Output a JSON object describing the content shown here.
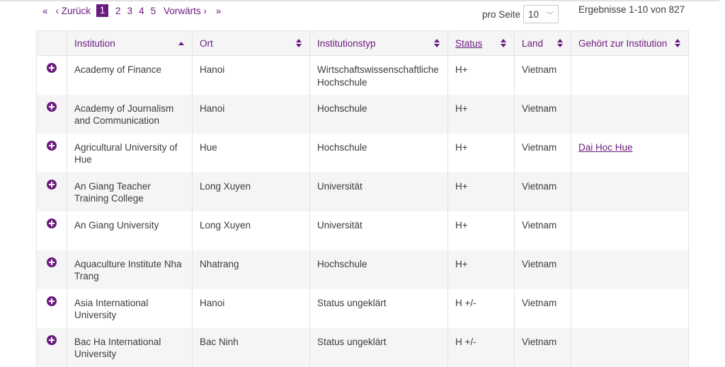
{
  "pagination": {
    "first": "«",
    "prev": "‹ Zurück",
    "pages": [
      "1",
      "2",
      "3",
      "4",
      "5"
    ],
    "current": "1",
    "next": "Vorwärts ›",
    "last": "»"
  },
  "per_page": {
    "label": "pro Seite",
    "value": "10"
  },
  "results": "Ergebnisse 1-10 von 827",
  "columns": {
    "institution": "Institution",
    "ort": "Ort",
    "typ": "Institutionstyp",
    "status": "Status",
    "land": "Land",
    "parent": "Gehört zur Institution"
  },
  "rows": [
    {
      "institution": "Academy of Finance",
      "ort": "Hanoi",
      "typ": "Wirtschaftswissenschaftliche Hochschule",
      "status": "H+",
      "land": "Vietnam",
      "parent": ""
    },
    {
      "institution": "Academy of Journalism and Communication",
      "ort": "Hanoi",
      "typ": "Hochschule",
      "status": "H+",
      "land": "Vietnam",
      "parent": ""
    },
    {
      "institution": "Agricultural University of Hue",
      "ort": "Hue",
      "typ": "Hochschule",
      "status": "H+",
      "land": "Vietnam",
      "parent": "Dai Hoc Hue"
    },
    {
      "institution": "An Giang Teacher Training College",
      "ort": "Long Xuyen",
      "typ": "Universität",
      "status": "H+",
      "land": "Vietnam",
      "parent": ""
    },
    {
      "institution": "An Giang University",
      "ort": "Long Xuyen",
      "typ": "Universität",
      "status": "H+",
      "land": "Vietnam",
      "parent": ""
    },
    {
      "institution": "Aquaculture Institute Nha Trang",
      "ort": "Nhatrang",
      "typ": "Hochschule",
      "status": "H+",
      "land": "Vietnam",
      "parent": ""
    },
    {
      "institution": "Asia International University",
      "ort": "Hanoi",
      "typ": "Status ungeklärt",
      "status": "H +/-",
      "land": "Vietnam",
      "parent": ""
    },
    {
      "institution": "Bac Ha International University",
      "ort": "Bac Ninh",
      "typ": "Status ungeklärt",
      "status": "H +/-",
      "land": "Vietnam",
      "parent": ""
    }
  ],
  "accent_color": "#6b1a7f"
}
